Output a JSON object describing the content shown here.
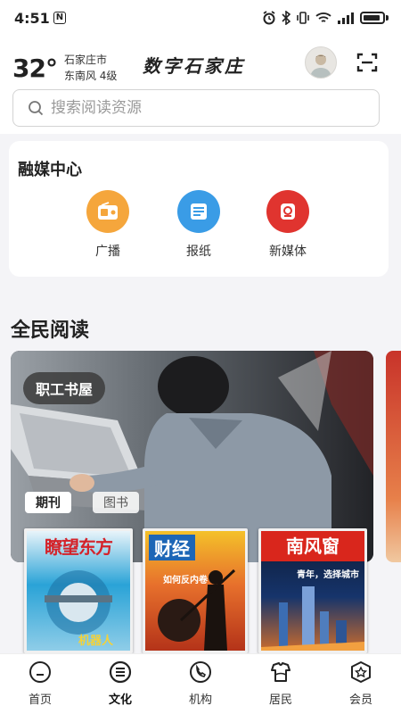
{
  "status_bar": {
    "time": "4:51",
    "nfc": "N"
  },
  "header": {
    "temperature": "32°",
    "city": "石家庄市",
    "wind": "东南风  4级",
    "app_title": "数字石家庄"
  },
  "search": {
    "placeholder": "搜索阅读资源"
  },
  "media_center": {
    "title": "融媒中心",
    "items": [
      {
        "label": "广播",
        "icon": "radio-icon",
        "color": "#f5a63c"
      },
      {
        "label": "报纸",
        "icon": "newspaper-icon",
        "color": "#3a9ce6"
      },
      {
        "label": "新媒体",
        "icon": "new-media-icon",
        "color": "#e0342f"
      }
    ]
  },
  "reading": {
    "title": "全民阅读",
    "banner_tag": "职工书屋",
    "chips": [
      "期刊",
      "图书"
    ],
    "magazines": [
      {
        "title": "瞭望东方",
        "subtitle": "机器人"
      },
      {
        "title": "财经",
        "subtitle": "如何反内卷"
      },
      {
        "title": "南风窗",
        "subtitle": "青年，选择城市"
      }
    ]
  },
  "bottom_nav": {
    "items": [
      {
        "label": "首页",
        "icon": "home-icon"
      },
      {
        "label": "文化",
        "icon": "culture-icon",
        "active": true
      },
      {
        "label": "机构",
        "icon": "phone-institution-icon"
      },
      {
        "label": "居民",
        "icon": "resident-icon"
      },
      {
        "label": "会员",
        "icon": "member-icon"
      }
    ]
  }
}
